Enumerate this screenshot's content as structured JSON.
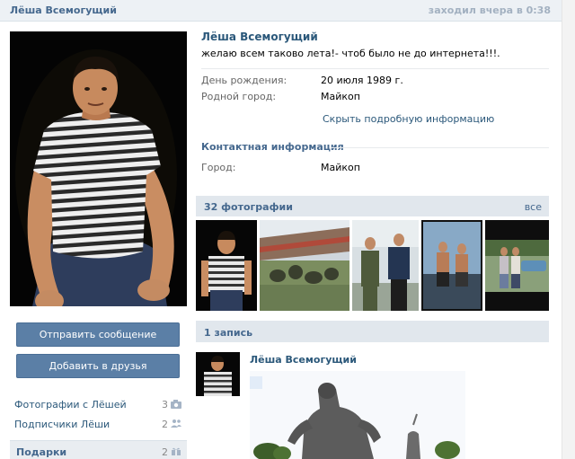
{
  "header": {
    "name": "Лёша Всемогущий",
    "last_seen": "заходил вчера в 0:38"
  },
  "profile": {
    "name": "Лёша Всемогущий",
    "status": "желаю всем таково лета!- чтоб было не до интернета!!!.",
    "fields": [
      {
        "label": "День рождения:",
        "value": "20 июля 1989 г."
      },
      {
        "label": "Родной город:",
        "value": "Майкоп"
      }
    ],
    "hide_details": "Скрыть подробную информацию",
    "contact_title": "Контактная информация",
    "contact_fields": [
      {
        "label": "Город:",
        "value": "Майкоп"
      }
    ]
  },
  "actions": {
    "send_message": "Отправить сообщение",
    "add_friend": "Добавить в друзья"
  },
  "left_links": [
    {
      "label": "Фотографии с Лёшей",
      "count": "3",
      "icon": "camera-icon"
    },
    {
      "label": "Подписчики Лёши",
      "count": "2",
      "icon": "people-icon"
    }
  ],
  "gifts": {
    "title": "Подарки",
    "count": "2",
    "icon": "gift-icon"
  },
  "photos": {
    "title": "32 фотографии",
    "all": "все"
  },
  "posts": {
    "title": "1 запись",
    "author": "Лёша Всемогущий"
  },
  "colors": {
    "link": "#2b587a",
    "header_text": "#45688e",
    "button": "#5b7fa6",
    "bar": "#e1e7ed"
  }
}
